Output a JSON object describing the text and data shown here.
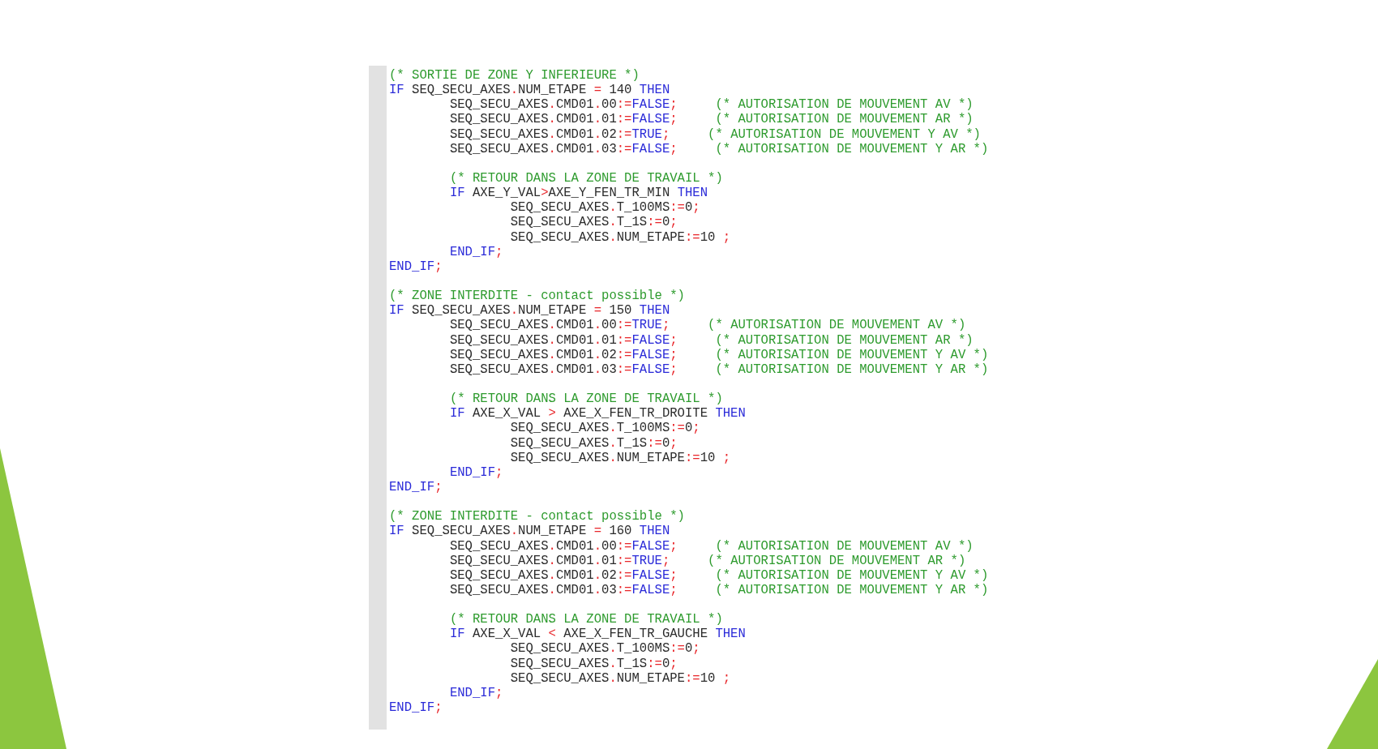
{
  "code_editor": {
    "lines": [
      {
        "kind": "code",
        "tokens": [
          {
            "kind": "comment",
            "text": "(* SORTIE DE ZONE Y INFERIEURE *)"
          }
        ]
      },
      {
        "kind": "code",
        "tokens": [
          {
            "kind": "keyword",
            "text": "IF"
          },
          {
            "kind": "plain",
            "text": " SEQ_SECU_AXES"
          },
          {
            "kind": "operator",
            "text": "."
          },
          {
            "kind": "plain",
            "text": "NUM_ETAPE "
          },
          {
            "kind": "operator",
            "text": "="
          },
          {
            "kind": "plain",
            "text": " 140 "
          },
          {
            "kind": "keyword",
            "text": "THEN"
          }
        ]
      },
      {
        "kind": "code",
        "tokens": [
          {
            "kind": "plain",
            "text": "\tSEQ_SECU_AXES"
          },
          {
            "kind": "operator",
            "text": "."
          },
          {
            "kind": "plain",
            "text": "CMD01"
          },
          {
            "kind": "operator",
            "text": "."
          },
          {
            "kind": "plain",
            "text": "00"
          },
          {
            "kind": "operator",
            "text": ":="
          },
          {
            "kind": "keyword",
            "text": "FALSE"
          },
          {
            "kind": "operator",
            "text": ";"
          },
          {
            "kind": "comment",
            "text": "     (* AUTORISATION DE MOUVEMENT AV *)"
          }
        ]
      },
      {
        "kind": "code",
        "tokens": [
          {
            "kind": "plain",
            "text": "\tSEQ_SECU_AXES"
          },
          {
            "kind": "operator",
            "text": "."
          },
          {
            "kind": "plain",
            "text": "CMD01"
          },
          {
            "kind": "operator",
            "text": "."
          },
          {
            "kind": "plain",
            "text": "01"
          },
          {
            "kind": "operator",
            "text": ":="
          },
          {
            "kind": "keyword",
            "text": "FALSE"
          },
          {
            "kind": "operator",
            "text": ";"
          },
          {
            "kind": "comment",
            "text": "     (* AUTORISATION DE MOUVEMENT AR *)"
          }
        ]
      },
      {
        "kind": "code",
        "tokens": [
          {
            "kind": "plain",
            "text": "\tSEQ_SECU_AXES"
          },
          {
            "kind": "operator",
            "text": "."
          },
          {
            "kind": "plain",
            "text": "CMD01"
          },
          {
            "kind": "operator",
            "text": "."
          },
          {
            "kind": "plain",
            "text": "02"
          },
          {
            "kind": "operator",
            "text": ":="
          },
          {
            "kind": "keyword",
            "text": "TRUE"
          },
          {
            "kind": "operator",
            "text": ";"
          },
          {
            "kind": "comment",
            "text": "     (* AUTORISATION DE MOUVEMENT Y AV *)"
          }
        ]
      },
      {
        "kind": "code",
        "tokens": [
          {
            "kind": "plain",
            "text": "\tSEQ_SECU_AXES"
          },
          {
            "kind": "operator",
            "text": "."
          },
          {
            "kind": "plain",
            "text": "CMD01"
          },
          {
            "kind": "operator",
            "text": "."
          },
          {
            "kind": "plain",
            "text": "03"
          },
          {
            "kind": "operator",
            "text": ":="
          },
          {
            "kind": "keyword",
            "text": "FALSE"
          },
          {
            "kind": "operator",
            "text": ";"
          },
          {
            "kind": "comment",
            "text": "     (* AUTORISATION DE MOUVEMENT Y AR *)"
          }
        ]
      },
      {
        "kind": "blank"
      },
      {
        "kind": "code",
        "tokens": [
          {
            "kind": "comment",
            "text": "\t(* RETOUR DANS LA ZONE DE TRAVAIL *)"
          }
        ]
      },
      {
        "kind": "code",
        "tokens": [
          {
            "kind": "keyword",
            "text": "\tIF"
          },
          {
            "kind": "plain",
            "text": " AXE_Y_VAL"
          },
          {
            "kind": "operator",
            "text": ">"
          },
          {
            "kind": "plain",
            "text": "AXE_Y_FEN_TR_MIN "
          },
          {
            "kind": "keyword",
            "text": "THEN"
          }
        ]
      },
      {
        "kind": "code",
        "tokens": [
          {
            "kind": "plain",
            "text": "\t\tSEQ_SECU_AXES"
          },
          {
            "kind": "operator",
            "text": "."
          },
          {
            "kind": "plain",
            "text": "T_100MS"
          },
          {
            "kind": "operator",
            "text": ":="
          },
          {
            "kind": "plain",
            "text": "0"
          },
          {
            "kind": "operator",
            "text": ";"
          }
        ]
      },
      {
        "kind": "code",
        "tokens": [
          {
            "kind": "plain",
            "text": "\t\tSEQ_SECU_AXES"
          },
          {
            "kind": "operator",
            "text": "."
          },
          {
            "kind": "plain",
            "text": "T_1S"
          },
          {
            "kind": "operator",
            "text": ":="
          },
          {
            "kind": "plain",
            "text": "0"
          },
          {
            "kind": "operator",
            "text": ";"
          }
        ]
      },
      {
        "kind": "code",
        "tokens": [
          {
            "kind": "plain",
            "text": "\t\tSEQ_SECU_AXES"
          },
          {
            "kind": "operator",
            "text": "."
          },
          {
            "kind": "plain",
            "text": "NUM_ETAPE"
          },
          {
            "kind": "operator",
            "text": ":="
          },
          {
            "kind": "plain",
            "text": "10 "
          },
          {
            "kind": "operator",
            "text": ";"
          }
        ]
      },
      {
        "kind": "code",
        "tokens": [
          {
            "kind": "keyword",
            "text": "\tEND_IF"
          },
          {
            "kind": "operator",
            "text": ";"
          }
        ]
      },
      {
        "kind": "code",
        "tokens": [
          {
            "kind": "keyword",
            "text": "END_IF"
          },
          {
            "kind": "operator",
            "text": ";"
          }
        ]
      },
      {
        "kind": "blank"
      },
      {
        "kind": "code",
        "tokens": [
          {
            "kind": "comment",
            "text": "(* ZONE INTERDITE - contact possible *)"
          }
        ]
      },
      {
        "kind": "code",
        "tokens": [
          {
            "kind": "keyword",
            "text": "IF"
          },
          {
            "kind": "plain",
            "text": " SEQ_SECU_AXES"
          },
          {
            "kind": "operator",
            "text": "."
          },
          {
            "kind": "plain",
            "text": "NUM_ETAPE "
          },
          {
            "kind": "operator",
            "text": "="
          },
          {
            "kind": "plain",
            "text": " 150 "
          },
          {
            "kind": "keyword",
            "text": "THEN"
          }
        ]
      },
      {
        "kind": "code",
        "tokens": [
          {
            "kind": "plain",
            "text": "\tSEQ_SECU_AXES"
          },
          {
            "kind": "operator",
            "text": "."
          },
          {
            "kind": "plain",
            "text": "CMD01"
          },
          {
            "kind": "operator",
            "text": "."
          },
          {
            "kind": "plain",
            "text": "00"
          },
          {
            "kind": "operator",
            "text": ":="
          },
          {
            "kind": "keyword",
            "text": "TRUE"
          },
          {
            "kind": "operator",
            "text": ";"
          },
          {
            "kind": "comment",
            "text": "     (* AUTORISATION DE MOUVEMENT AV *)"
          }
        ]
      },
      {
        "kind": "code",
        "tokens": [
          {
            "kind": "plain",
            "text": "\tSEQ_SECU_AXES"
          },
          {
            "kind": "operator",
            "text": "."
          },
          {
            "kind": "plain",
            "text": "CMD01"
          },
          {
            "kind": "operator",
            "text": "."
          },
          {
            "kind": "plain",
            "text": "01"
          },
          {
            "kind": "operator",
            "text": ":="
          },
          {
            "kind": "keyword",
            "text": "FALSE"
          },
          {
            "kind": "operator",
            "text": ";"
          },
          {
            "kind": "comment",
            "text": "     (* AUTORISATION DE MOUVEMENT AR *)"
          }
        ]
      },
      {
        "kind": "code",
        "tokens": [
          {
            "kind": "plain",
            "text": "\tSEQ_SECU_AXES"
          },
          {
            "kind": "operator",
            "text": "."
          },
          {
            "kind": "plain",
            "text": "CMD01"
          },
          {
            "kind": "operator",
            "text": "."
          },
          {
            "kind": "plain",
            "text": "02"
          },
          {
            "kind": "operator",
            "text": ":="
          },
          {
            "kind": "keyword",
            "text": "FALSE"
          },
          {
            "kind": "operator",
            "text": ";"
          },
          {
            "kind": "comment",
            "text": "     (* AUTORISATION DE MOUVEMENT Y AV *)"
          }
        ]
      },
      {
        "kind": "code",
        "tokens": [
          {
            "kind": "plain",
            "text": "\tSEQ_SECU_AXES"
          },
          {
            "kind": "operator",
            "text": "."
          },
          {
            "kind": "plain",
            "text": "CMD01"
          },
          {
            "kind": "operator",
            "text": "."
          },
          {
            "kind": "plain",
            "text": "03"
          },
          {
            "kind": "operator",
            "text": ":="
          },
          {
            "kind": "keyword",
            "text": "FALSE"
          },
          {
            "kind": "operator",
            "text": ";"
          },
          {
            "kind": "comment",
            "text": "     (* AUTORISATION DE MOUVEMENT Y AR *)"
          }
        ]
      },
      {
        "kind": "blank"
      },
      {
        "kind": "code",
        "tokens": [
          {
            "kind": "comment",
            "text": "\t(* RETOUR DANS LA ZONE DE TRAVAIL *)"
          }
        ]
      },
      {
        "kind": "code",
        "tokens": [
          {
            "kind": "keyword",
            "text": "\tIF"
          },
          {
            "kind": "plain",
            "text": " AXE_X_VAL "
          },
          {
            "kind": "operator",
            "text": ">"
          },
          {
            "kind": "plain",
            "text": " AXE_X_FEN_TR_DROITE "
          },
          {
            "kind": "keyword",
            "text": "THEN"
          }
        ]
      },
      {
        "kind": "code",
        "tokens": [
          {
            "kind": "plain",
            "text": "\t\tSEQ_SECU_AXES"
          },
          {
            "kind": "operator",
            "text": "."
          },
          {
            "kind": "plain",
            "text": "T_100MS"
          },
          {
            "kind": "operator",
            "text": ":="
          },
          {
            "kind": "plain",
            "text": "0"
          },
          {
            "kind": "operator",
            "text": ";"
          }
        ]
      },
      {
        "kind": "code",
        "tokens": [
          {
            "kind": "plain",
            "text": "\t\tSEQ_SECU_AXES"
          },
          {
            "kind": "operator",
            "text": "."
          },
          {
            "kind": "plain",
            "text": "T_1S"
          },
          {
            "kind": "operator",
            "text": ":="
          },
          {
            "kind": "plain",
            "text": "0"
          },
          {
            "kind": "operator",
            "text": ";"
          }
        ]
      },
      {
        "kind": "code",
        "tokens": [
          {
            "kind": "plain",
            "text": "\t\tSEQ_SECU_AXES"
          },
          {
            "kind": "operator",
            "text": "."
          },
          {
            "kind": "plain",
            "text": "NUM_ETAPE"
          },
          {
            "kind": "operator",
            "text": ":="
          },
          {
            "kind": "plain",
            "text": "10 "
          },
          {
            "kind": "operator",
            "text": ";"
          }
        ]
      },
      {
        "kind": "code",
        "tokens": [
          {
            "kind": "keyword",
            "text": "\tEND_IF"
          },
          {
            "kind": "operator",
            "text": ";"
          }
        ]
      },
      {
        "kind": "code",
        "tokens": [
          {
            "kind": "keyword",
            "text": "END_IF"
          },
          {
            "kind": "operator",
            "text": ";"
          }
        ]
      },
      {
        "kind": "blank"
      },
      {
        "kind": "code",
        "tokens": [
          {
            "kind": "comment",
            "text": "(* ZONE INTERDITE - contact possible *)"
          }
        ]
      },
      {
        "kind": "code",
        "tokens": [
          {
            "kind": "keyword",
            "text": "IF"
          },
          {
            "kind": "plain",
            "text": " SEQ_SECU_AXES"
          },
          {
            "kind": "operator",
            "text": "."
          },
          {
            "kind": "plain",
            "text": "NUM_ETAPE "
          },
          {
            "kind": "operator",
            "text": "="
          },
          {
            "kind": "plain",
            "text": " 160 "
          },
          {
            "kind": "keyword",
            "text": "THEN"
          }
        ]
      },
      {
        "kind": "code",
        "tokens": [
          {
            "kind": "plain",
            "text": "\tSEQ_SECU_AXES"
          },
          {
            "kind": "operator",
            "text": "."
          },
          {
            "kind": "plain",
            "text": "CMD01"
          },
          {
            "kind": "operator",
            "text": "."
          },
          {
            "kind": "plain",
            "text": "00"
          },
          {
            "kind": "operator",
            "text": ":="
          },
          {
            "kind": "keyword",
            "text": "FALSE"
          },
          {
            "kind": "operator",
            "text": ";"
          },
          {
            "kind": "comment",
            "text": "     (* AUTORISATION DE MOUVEMENT AV *)"
          }
        ]
      },
      {
        "kind": "code",
        "tokens": [
          {
            "kind": "plain",
            "text": "\tSEQ_SECU_AXES"
          },
          {
            "kind": "operator",
            "text": "."
          },
          {
            "kind": "plain",
            "text": "CMD01"
          },
          {
            "kind": "operator",
            "text": "."
          },
          {
            "kind": "plain",
            "text": "01"
          },
          {
            "kind": "operator",
            "text": ":="
          },
          {
            "kind": "keyword",
            "text": "TRUE"
          },
          {
            "kind": "operator",
            "text": ";"
          },
          {
            "kind": "comment",
            "text": "     (* AUTORISATION DE MOUVEMENT AR *)"
          }
        ]
      },
      {
        "kind": "code",
        "tokens": [
          {
            "kind": "plain",
            "text": "\tSEQ_SECU_AXES"
          },
          {
            "kind": "operator",
            "text": "."
          },
          {
            "kind": "plain",
            "text": "CMD01"
          },
          {
            "kind": "operator",
            "text": "."
          },
          {
            "kind": "plain",
            "text": "02"
          },
          {
            "kind": "operator",
            "text": ":="
          },
          {
            "kind": "keyword",
            "text": "FALSE"
          },
          {
            "kind": "operator",
            "text": ";"
          },
          {
            "kind": "comment",
            "text": "     (* AUTORISATION DE MOUVEMENT Y AV *)"
          }
        ]
      },
      {
        "kind": "code",
        "tokens": [
          {
            "kind": "plain",
            "text": "\tSEQ_SECU_AXES"
          },
          {
            "kind": "operator",
            "text": "."
          },
          {
            "kind": "plain",
            "text": "CMD01"
          },
          {
            "kind": "operator",
            "text": "."
          },
          {
            "kind": "plain",
            "text": "03"
          },
          {
            "kind": "operator",
            "text": ":="
          },
          {
            "kind": "keyword",
            "text": "FALSE"
          },
          {
            "kind": "operator",
            "text": ";"
          },
          {
            "kind": "comment",
            "text": "     (* AUTORISATION DE MOUVEMENT Y AR *)"
          }
        ]
      },
      {
        "kind": "blank"
      },
      {
        "kind": "code",
        "tokens": [
          {
            "kind": "comment",
            "text": "\t(* RETOUR DANS LA ZONE DE TRAVAIL *)"
          }
        ]
      },
      {
        "kind": "code",
        "tokens": [
          {
            "kind": "keyword",
            "text": "\tIF"
          },
          {
            "kind": "plain",
            "text": " AXE_X_VAL "
          },
          {
            "kind": "operator",
            "text": "<"
          },
          {
            "kind": "plain",
            "text": " AXE_X_FEN_TR_GAUCHE "
          },
          {
            "kind": "keyword",
            "text": "THEN"
          }
        ]
      },
      {
        "kind": "code",
        "tokens": [
          {
            "kind": "plain",
            "text": "\t\tSEQ_SECU_AXES"
          },
          {
            "kind": "operator",
            "text": "."
          },
          {
            "kind": "plain",
            "text": "T_100MS"
          },
          {
            "kind": "operator",
            "text": ":="
          },
          {
            "kind": "plain",
            "text": "0"
          },
          {
            "kind": "operator",
            "text": ";"
          }
        ]
      },
      {
        "kind": "code",
        "tokens": [
          {
            "kind": "plain",
            "text": "\t\tSEQ_SECU_AXES"
          },
          {
            "kind": "operator",
            "text": "."
          },
          {
            "kind": "plain",
            "text": "T_1S"
          },
          {
            "kind": "operator",
            "text": ":="
          },
          {
            "kind": "plain",
            "text": "0"
          },
          {
            "kind": "operator",
            "text": ";"
          }
        ]
      },
      {
        "kind": "code",
        "tokens": [
          {
            "kind": "plain",
            "text": "\t\tSEQ_SECU_AXES"
          },
          {
            "kind": "operator",
            "text": "."
          },
          {
            "kind": "plain",
            "text": "NUM_ETAPE"
          },
          {
            "kind": "operator",
            "text": ":="
          },
          {
            "kind": "plain",
            "text": "10 "
          },
          {
            "kind": "operator",
            "text": ";"
          }
        ]
      },
      {
        "kind": "code",
        "tokens": [
          {
            "kind": "keyword",
            "text": "\tEND_IF"
          },
          {
            "kind": "operator",
            "text": ";"
          }
        ]
      },
      {
        "kind": "code",
        "tokens": [
          {
            "kind": "keyword",
            "text": "END_IF"
          },
          {
            "kind": "operator",
            "text": ";"
          }
        ]
      }
    ]
  }
}
